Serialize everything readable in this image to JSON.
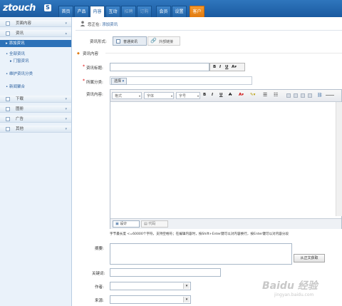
{
  "header": {
    "logo": "ztouch",
    "logo_badge": "S",
    "tabs": [
      {
        "label": "首页",
        "state": "normal"
      },
      {
        "label": "产品",
        "state": "normal"
      },
      {
        "label": "内容",
        "state": "active"
      },
      {
        "label": "互动",
        "state": "normal"
      },
      {
        "label": "招聘",
        "state": "disabled"
      },
      {
        "label": "订购",
        "state": "disabled"
      },
      {
        "label": "会员",
        "state": "normal"
      },
      {
        "label": "设置",
        "state": "normal"
      },
      {
        "label": "客户",
        "state": "highlight"
      }
    ]
  },
  "sidebar": {
    "groups": [
      {
        "label": "页面内容"
      },
      {
        "label": "资讯"
      },
      {
        "label": "下载"
      },
      {
        "label": "图册"
      },
      {
        "label": "广告"
      },
      {
        "label": "其他"
      }
    ],
    "active_item": "添加资讯",
    "links": [
      "全部资讯",
      "门窗资讯",
      "维护资讯分类",
      "新闻聚合"
    ]
  },
  "breadcrumb": {
    "prefix": "您正在:",
    "current": "添加资讯"
  },
  "form": {
    "type_label": "资讯形式:",
    "type_normal": "普通资讯",
    "type_external": "外部链接",
    "section_title": "资讯内容",
    "title_label": "资讯标题:",
    "category_label": "所属分类:",
    "category_select": "选择",
    "content_label": "资讯内容:",
    "editor": {
      "style_select": "格式",
      "font_select": "字体",
      "size_select": "字号",
      "bold": "B",
      "italic": "I",
      "underline": "U",
      "strike": "A",
      "design_tab": "设计",
      "code_tab": "代码"
    },
    "content_hint": "字节最长度 <=60000个字符，支持空格符；在编辑内容时，按Shift+Enter键可以对内容换行，按Enter键可以对内容分段",
    "summary_label": "摘要:",
    "summary_button": "从正文获取",
    "keywords_label": "关键词:",
    "author_label": "作者:",
    "source_label": "来源:"
  },
  "watermark": {
    "text": "Baidu 经验",
    "subtext": "jingyan.baidu.com"
  },
  "colors": {
    "header_blue": "#1a5aa0",
    "active_blue": "#2d72b8",
    "orange": "#e8841a",
    "required": "#dd0000"
  }
}
